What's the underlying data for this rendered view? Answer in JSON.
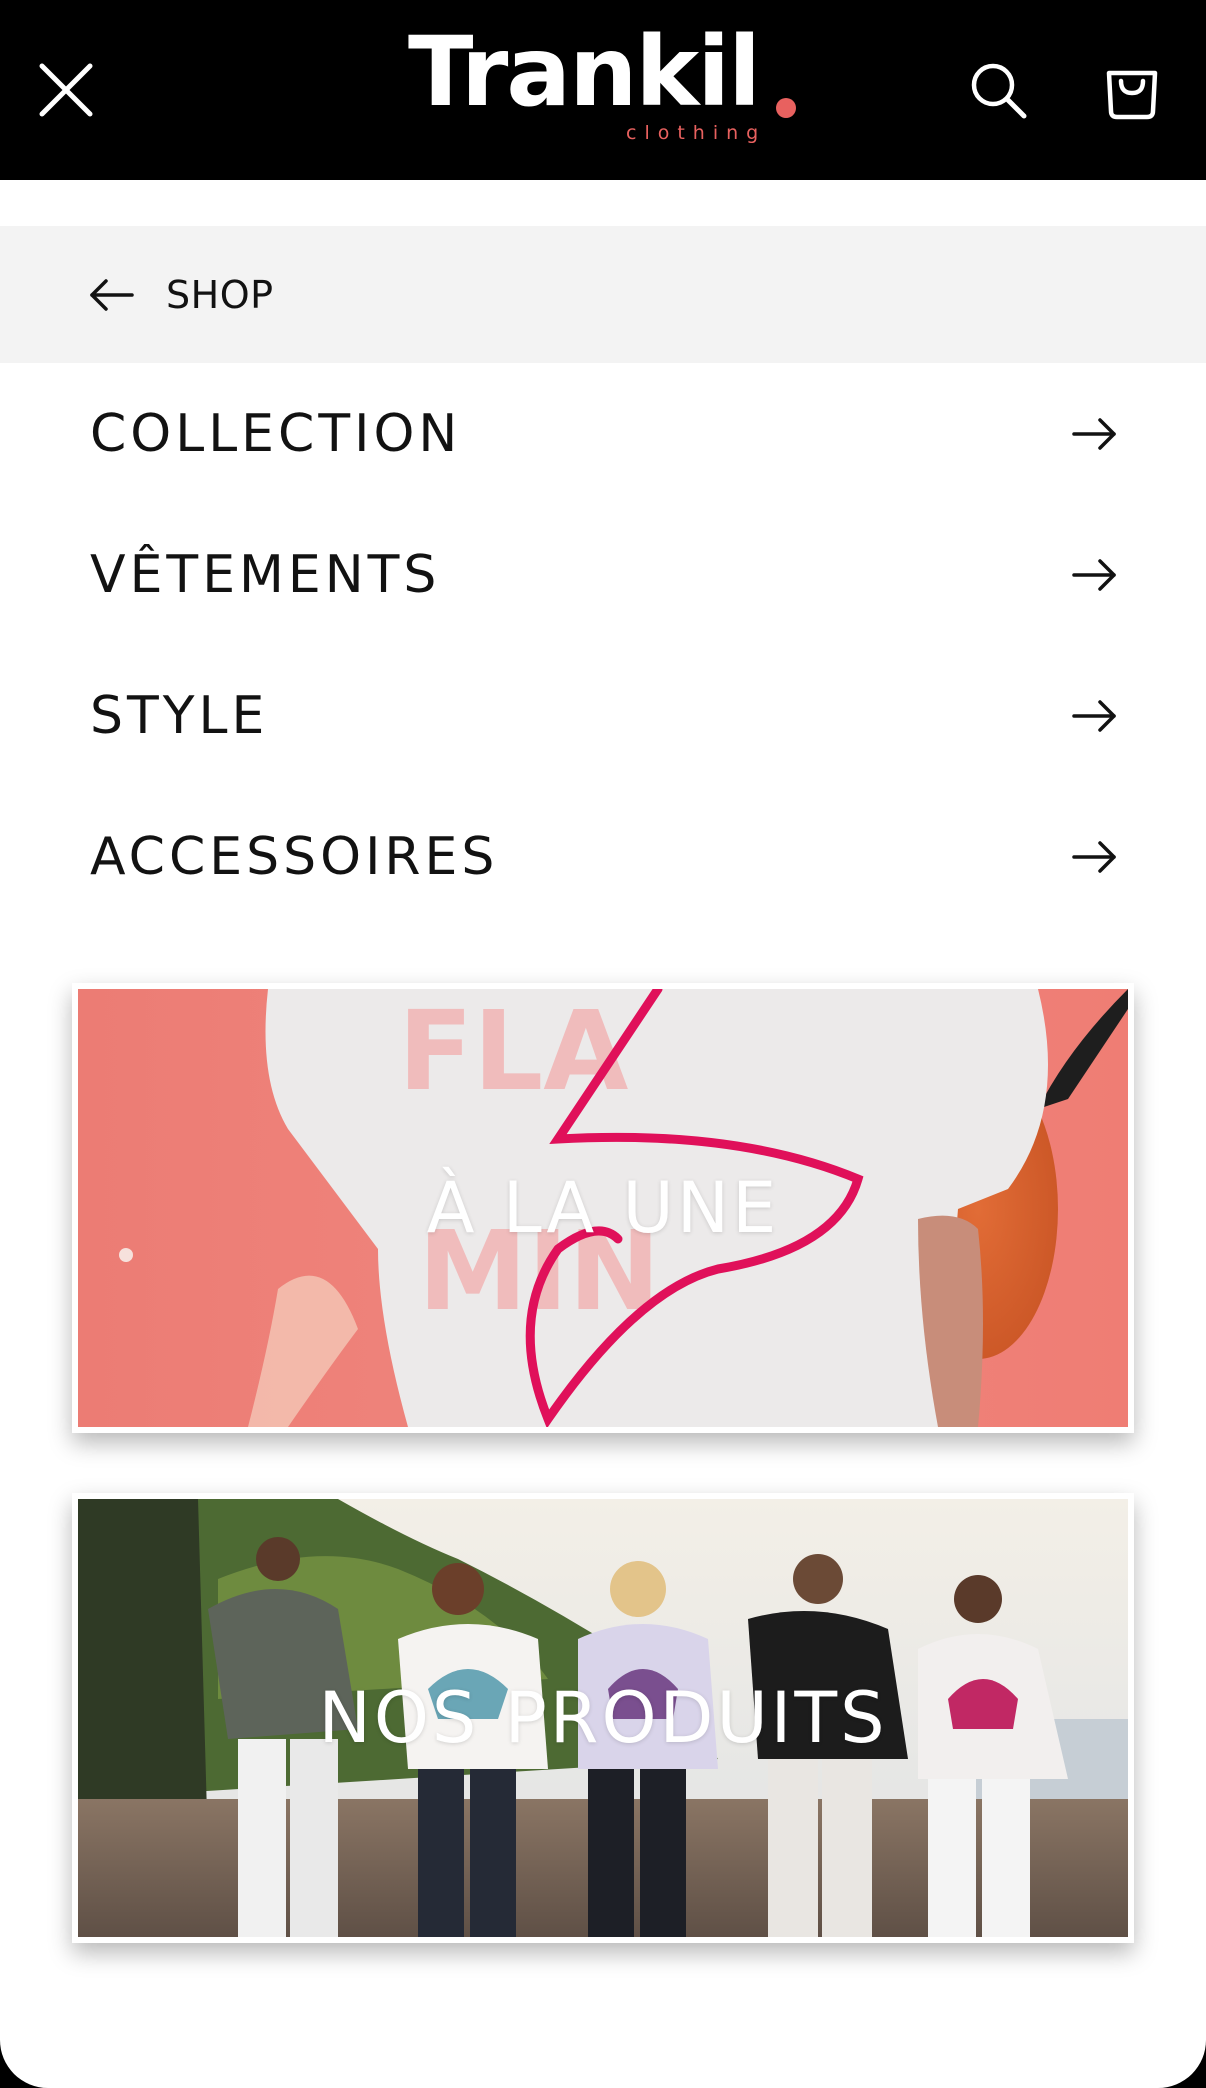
{
  "header": {
    "logo_text": "Trankil",
    "logo_subtext": "clothing",
    "close_icon": "close-icon",
    "search_icon": "search-icon",
    "cart_icon": "cart-icon",
    "accent_color": "#e8615f"
  },
  "back": {
    "label": "SHOP",
    "icon": "arrow-left-icon"
  },
  "menu": {
    "items": [
      {
        "label": "COLLECTION",
        "icon": "arrow-right-icon"
      },
      {
        "label": "VÊTEMENTS",
        "icon": "arrow-right-icon"
      },
      {
        "label": "STYLE",
        "icon": "arrow-right-icon"
      },
      {
        "label": "ACCESSOIRES",
        "icon": "arrow-right-icon"
      }
    ]
  },
  "cards": [
    {
      "label": "À LA UNE"
    },
    {
      "label": "NOS PRODUITS"
    }
  ]
}
